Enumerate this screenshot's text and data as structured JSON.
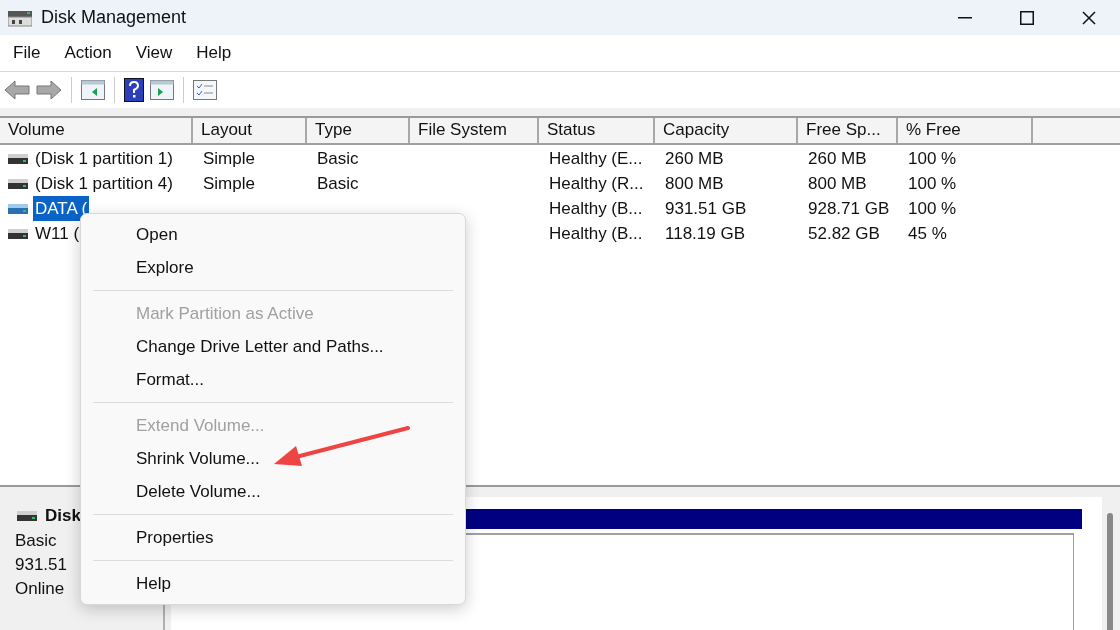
{
  "window": {
    "title": "Disk Management"
  },
  "menu_bar": [
    "File",
    "Action",
    "View",
    "Help"
  ],
  "table": {
    "columns": [
      "Volume",
      "Layout",
      "Type",
      "File System",
      "Status",
      "Capacity",
      "Free Sp...",
      "% Free"
    ],
    "rows": [
      {
        "selected": false,
        "cells": [
          "(Disk 1 partition 1)",
          "Simple",
          "Basic",
          "",
          "Healthy (E...",
          "260 MB",
          "260 MB",
          "100 %"
        ]
      },
      {
        "selected": false,
        "cells": [
          "(Disk 1 partition 4)",
          "Simple",
          "Basic",
          "",
          "Healthy (R...",
          "800 MB",
          "800 MB",
          "100 %"
        ]
      },
      {
        "selected": true,
        "cells": [
          "DATA (",
          "",
          "",
          "",
          "Healthy (B...",
          "931.51 GB",
          "928.71 GB",
          "100 %"
        ]
      },
      {
        "selected": false,
        "cells": [
          "W11 (",
          "",
          "",
          "",
          "Healthy (B...",
          "118.19 GB",
          "52.82 GB",
          "45 %"
        ]
      }
    ]
  },
  "disk_panel": {
    "name": "Disk",
    "lines": [
      "Basic",
      "931.51",
      "Online"
    ]
  },
  "context_menu": [
    {
      "kind": "item",
      "label": "Open",
      "disabled": false
    },
    {
      "kind": "item",
      "label": "Explore",
      "disabled": false
    },
    {
      "kind": "separator"
    },
    {
      "kind": "item",
      "label": "Mark Partition as Active",
      "disabled": true
    },
    {
      "kind": "item",
      "label": "Change Drive Letter and Paths...",
      "disabled": false
    },
    {
      "kind": "item",
      "label": "Format...",
      "disabled": false
    },
    {
      "kind": "separator"
    },
    {
      "kind": "item",
      "label": "Extend Volume...",
      "disabled": true
    },
    {
      "kind": "item",
      "label": "Shrink Volume...",
      "disabled": false
    },
    {
      "kind": "item",
      "label": "Delete Volume...",
      "disabled": false
    },
    {
      "kind": "separator"
    },
    {
      "kind": "item",
      "label": "Properties",
      "disabled": false
    },
    {
      "kind": "separator"
    },
    {
      "kind": "item",
      "label": "Help",
      "disabled": false
    }
  ]
}
